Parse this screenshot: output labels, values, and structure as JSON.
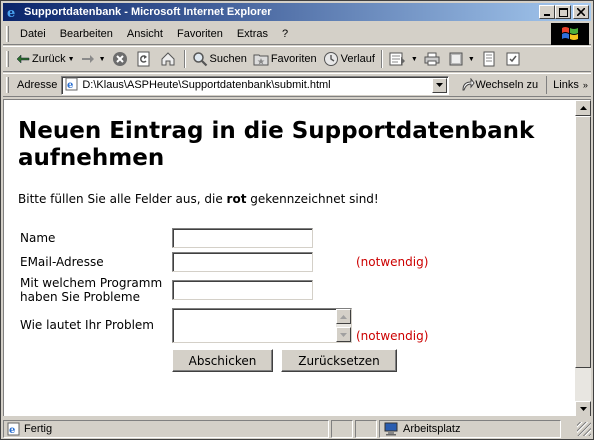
{
  "window": {
    "title": "Supportdatenbank - Microsoft Internet Explorer"
  },
  "menubar": {
    "items": [
      "Datei",
      "Bearbeiten",
      "Ansicht",
      "Favoriten",
      "Extras",
      "?"
    ]
  },
  "toolbar": {
    "back_label": "Zurück",
    "search_label": "Suchen",
    "favorites_label": "Favoriten",
    "history_label": "Verlauf"
  },
  "addressbar": {
    "label": "Adresse",
    "url": "D:\\Klaus\\ASPHeute\\Supportdatenbank\\submit.html",
    "go_label": "Wechseln zu",
    "links_label": "Links"
  },
  "page": {
    "heading": "Neuen Eintrag in die Supportdatenbank aufnehmen",
    "intro_before": "Bitte füllen Sie alle Felder aus, die ",
    "intro_bold": "rot",
    "intro_after": " gekennzeichnet sind!",
    "form": {
      "name_label": "Name",
      "name_value": "",
      "email_label": "EMail-Adresse",
      "email_value": "",
      "email_required": "(notwendig)",
      "program_label": "Mit welchem Programm haben Sie Probleme",
      "program_value": "",
      "problem_label": "Wie lautet Ihr Problem",
      "problem_value": "",
      "problem_required": "(notwendig)",
      "submit_label": "Abschicken",
      "reset_label": "Zurücksetzen"
    },
    "required_color": "#cc0000"
  },
  "statusbar": {
    "status_text": "Fertig",
    "zone_text": "Arbeitsplatz"
  }
}
